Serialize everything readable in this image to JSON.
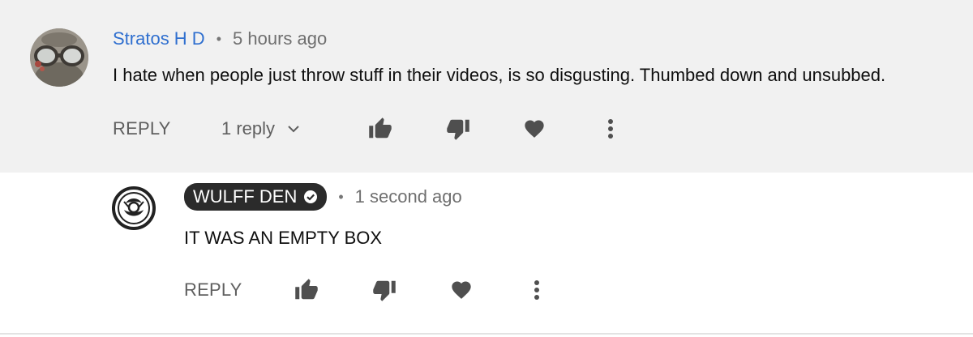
{
  "comment": {
    "author": "Stratos H D",
    "separator": "•",
    "time": "5 hours ago",
    "text": "I hate when people just throw stuff in their videos, is so disgusting. Thumbed down and unsubbed.",
    "reply_label": "REPLY",
    "replies_toggle_label": "1 reply",
    "icons": [
      "like-icon",
      "dislike-icon",
      "heart-icon",
      "more-vert-icon",
      "chevron-down-icon"
    ]
  },
  "reply": {
    "author": "WULFF DEN",
    "author_badge": "verified-check-icon",
    "separator": "•",
    "time": "1 second ago",
    "text": "IT WAS AN EMPTY BOX",
    "reply_label": "REPLY",
    "icons": [
      "like-icon",
      "dislike-icon",
      "heart-icon",
      "more-vert-icon"
    ]
  },
  "colors": {
    "comment_background": "#f1f1f1",
    "reply_background": "#ffffff",
    "author_link": "#2f6fcf",
    "creator_chip": "#2b2b2b",
    "icon_gray": "#4f4f4f"
  }
}
